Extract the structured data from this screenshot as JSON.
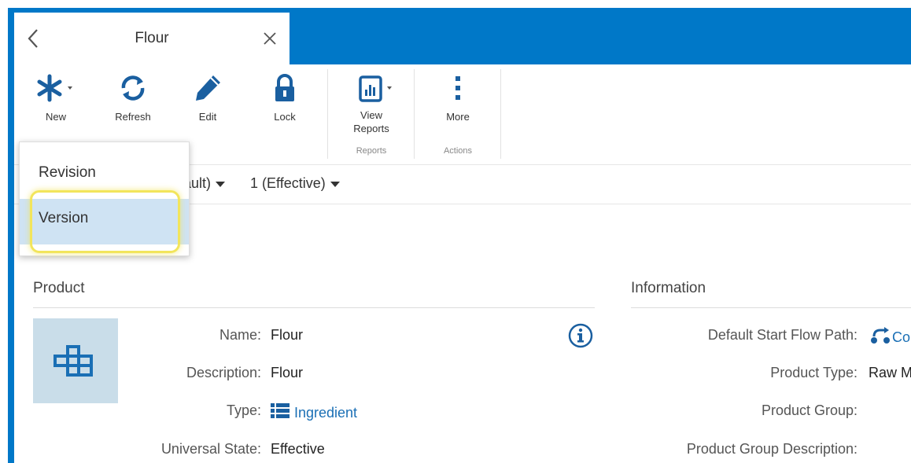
{
  "tab": {
    "title": "Flour"
  },
  "ribbon": {
    "buttons": [
      {
        "label": "New",
        "icon": "asterisk-icon"
      },
      {
        "label": "Refresh",
        "icon": "refresh-icon"
      },
      {
        "label": "Edit",
        "icon": "pencil-icon"
      },
      {
        "label": "Lock",
        "icon": "lock-icon"
      },
      {
        "label": "View\nReports",
        "icon": "report-icon"
      },
      {
        "label": "More",
        "icon": "more-vertical-icon"
      }
    ],
    "groups": [
      "Reports",
      "Actions"
    ]
  },
  "filter": {
    "revision_tail": "fault)",
    "version": "1 (Effective)"
  },
  "dropdown": {
    "items": [
      "Revision",
      "Version"
    ],
    "selected": "Version"
  },
  "product": {
    "section_title": "Product",
    "fields": [
      {
        "label": "Name:",
        "value": "Flour"
      },
      {
        "label": "Description:",
        "value": "Flour"
      },
      {
        "label": "Type:",
        "value": "Ingredient"
      },
      {
        "label": "Universal State:",
        "value": "Effective"
      }
    ]
  },
  "information": {
    "section_title": "Information",
    "fields": [
      {
        "label": "Default Start Flow Path:",
        "value": "Co"
      },
      {
        "label": "Product Type:",
        "value": "Raw M"
      },
      {
        "label": "Product Group:",
        "value": ""
      },
      {
        "label": "Product Group Description:",
        "value": ""
      }
    ]
  },
  "colors": {
    "brand_blue": "#0078c8",
    "accent_blue": "#1a6fb5",
    "thumb_bg": "#c9dde9",
    "highlight": "#f2e55c"
  }
}
